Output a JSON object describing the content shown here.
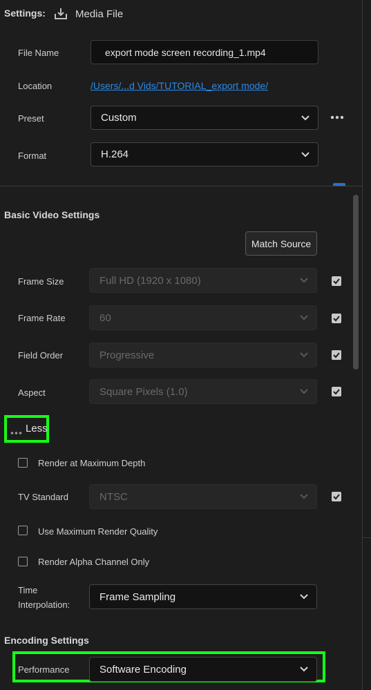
{
  "settings": {
    "title": "Settings:",
    "output_type_label": "Media File"
  },
  "file": {
    "name_label": "File Name",
    "name_value": "export mode screen recording_1.mp4",
    "location_label": "Location",
    "location_value": "/Users/...d Vids/TUTORIAL_export mode/",
    "preset_label": "Preset",
    "preset_value": "Custom",
    "format_label": "Format",
    "format_value": "H.264"
  },
  "video": {
    "heading": "Basic Video Settings",
    "match_source_label": "Match Source",
    "frame_size_label": "Frame Size",
    "frame_size_value": "Full HD (1920 x 1080)",
    "frame_rate_label": "Frame Rate",
    "frame_rate_value": "60",
    "field_order_label": "Field Order",
    "field_order_value": "Progressive",
    "aspect_label": "Aspect",
    "aspect_value": "Square Pixels (1.0)",
    "less_label": "Less",
    "render_max_depth_label": "Render at Maximum Depth",
    "tv_standard_label": "TV Standard",
    "tv_standard_value": "NTSC",
    "max_render_quality_label": "Use Maximum Render Quality",
    "render_alpha_label": "Render Alpha Channel Only",
    "time_interp_label_1": "Time",
    "time_interp_label_2": "Interpolation:",
    "time_interp_value": "Frame Sampling"
  },
  "encoding": {
    "heading": "Encoding Settings",
    "performance_label": "Performance",
    "performance_value": "Software Encoding"
  },
  "colors": {
    "highlight": "#16ff16",
    "link": "#2b8ae8",
    "background": "#1d1d1d"
  }
}
